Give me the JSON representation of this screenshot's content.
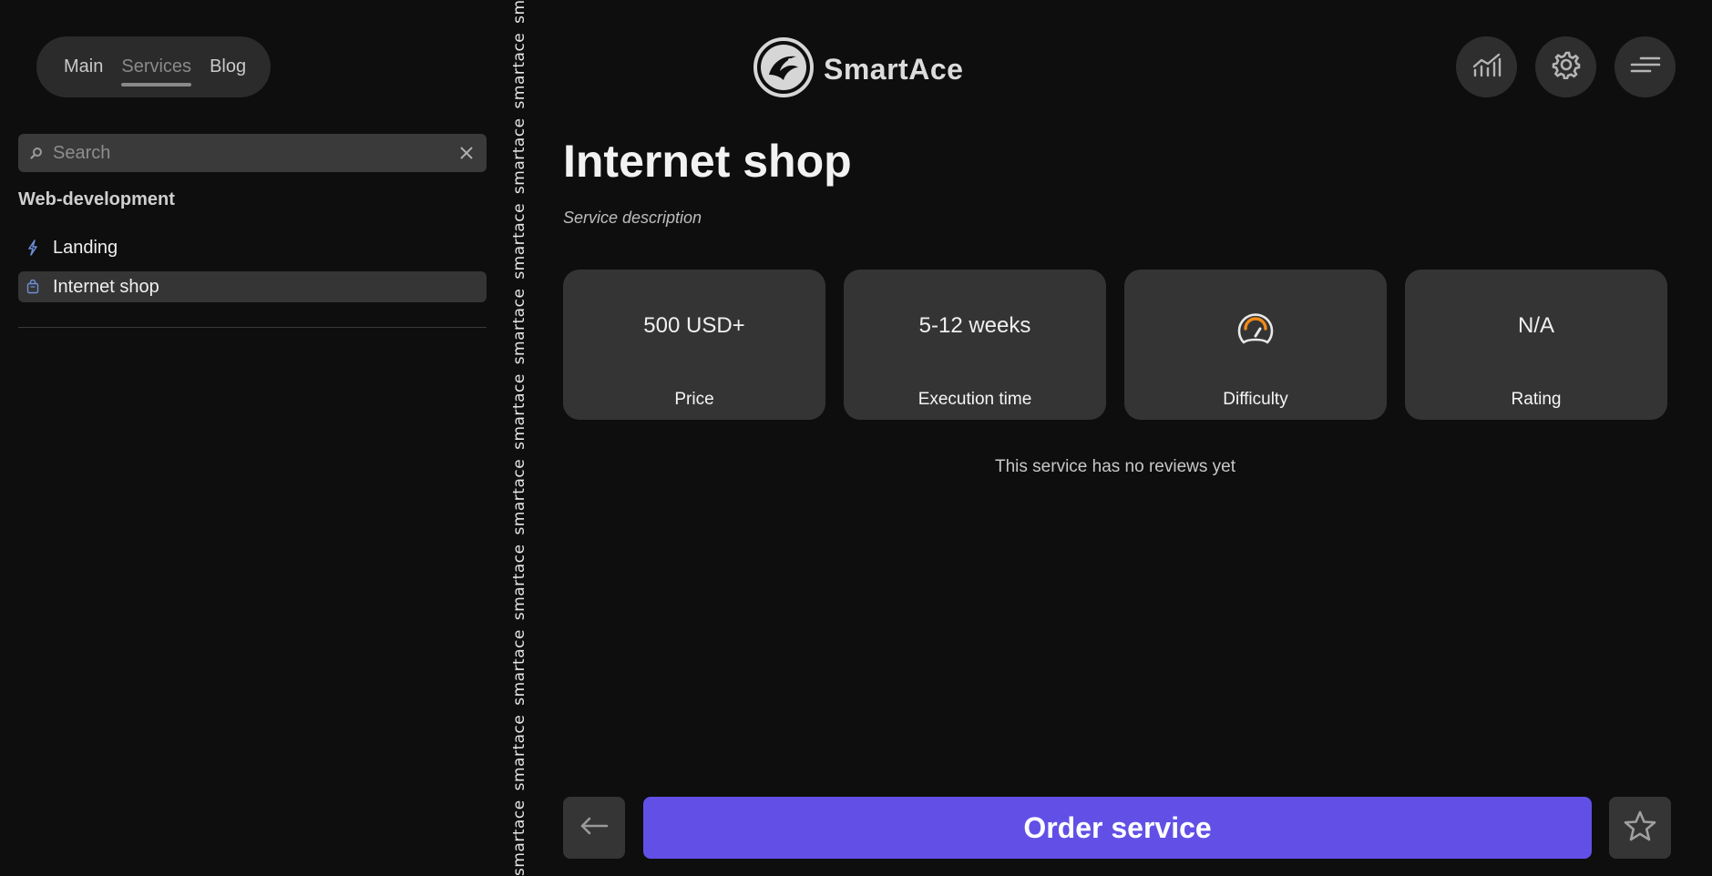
{
  "nav": {
    "items": [
      {
        "label": "Main",
        "active": false
      },
      {
        "label": "Services",
        "active": true
      },
      {
        "label": "Blog",
        "active": false
      }
    ]
  },
  "search": {
    "placeholder": "Search",
    "value": ""
  },
  "sidebar": {
    "category": "Web-development",
    "items": [
      {
        "label": "Landing",
        "icon": "lightning-icon",
        "selected": false
      },
      {
        "label": "Internet shop",
        "icon": "shopping-bag-icon",
        "selected": true
      }
    ]
  },
  "strip": {
    "word": "smartace"
  },
  "header": {
    "brand": "SmartAce",
    "buttons": [
      "stats-chart-icon",
      "gear-icon",
      "menu-icon"
    ]
  },
  "service": {
    "title": "Internet shop",
    "description": "Service description",
    "stats": {
      "price": {
        "value": "500 USD+",
        "label": "Price"
      },
      "execution": {
        "value": "5-12 weeks",
        "label": "Execution time"
      },
      "difficulty": {
        "label": "Difficulty",
        "icon": "speedometer-icon"
      },
      "rating": {
        "value": "N/A",
        "label": "Rating"
      }
    },
    "reviews_text": "This service has no reviews yet"
  },
  "actions": {
    "order_label": "Order service"
  },
  "colors": {
    "background": "#0e0e0e",
    "accent": "#6250e6",
    "card": "#353434",
    "gauge": "#f08a18",
    "icon_blue": "#6f8fd8"
  }
}
